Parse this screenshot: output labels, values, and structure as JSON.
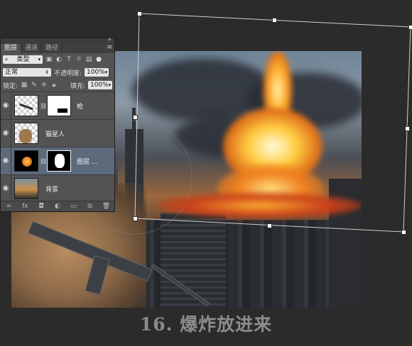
{
  "layers_panel": {
    "collapse_icon": "double-chevron-right",
    "tabs": [
      {
        "label": "图层"
      },
      {
        "label": "通道"
      },
      {
        "label": "路径"
      }
    ],
    "filter": {
      "label": "类型"
    },
    "blend_mode": {
      "value": "正常"
    },
    "opacity": {
      "label": "不透明度:",
      "value": "100%"
    },
    "lock": {
      "label": "锁定:"
    },
    "fill": {
      "label": "填充:",
      "value": "100%"
    },
    "layers": [
      {
        "name": "枪",
        "selected": false
      },
      {
        "name": "猫星人",
        "selected": false
      },
      {
        "name": "图层 ...",
        "selected": true
      },
      {
        "name": "背景",
        "selected": false
      }
    ]
  },
  "caption": "16. 爆炸放进来"
}
